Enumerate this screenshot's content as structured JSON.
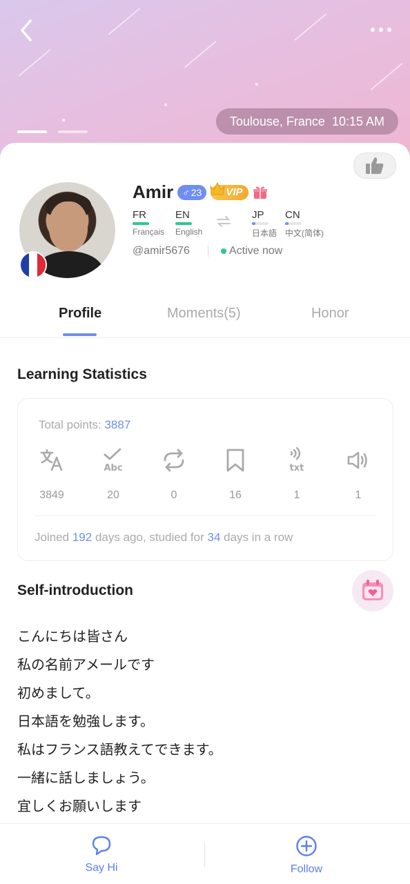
{
  "header": {
    "location": "Toulouse, France",
    "local_time": "10:15 AM",
    "gallery_pages": 2
  },
  "profile": {
    "name": "Amir",
    "gender_symbol": "♂",
    "age": "23",
    "vip_label": "VIP",
    "handle": "@amir5676",
    "status": "Active now",
    "native_languages": [
      {
        "code": "FR",
        "name": "Français",
        "level": 1.0
      },
      {
        "code": "EN",
        "name": "English",
        "level": 1.0
      }
    ],
    "learning_languages": [
      {
        "code": "JP",
        "name": "日本語",
        "level": 0.2
      },
      {
        "code": "CN",
        "name": "中文(简体)",
        "level": 0.2
      }
    ]
  },
  "tabs": [
    {
      "label": "Profile",
      "active": true
    },
    {
      "label": "Moments(5)",
      "active": false
    },
    {
      "label": "Honor",
      "active": false
    }
  ],
  "learning_statistics": {
    "title": "Learning Statistics",
    "total_points_label": "Total points:",
    "total_points": "3887",
    "stats": [
      {
        "icon": "translate-icon",
        "value": "3849"
      },
      {
        "icon": "spellcheck-icon",
        "value": "20"
      },
      {
        "icon": "repeat-icon",
        "value": "0"
      },
      {
        "icon": "bookmark-icon",
        "value": "16"
      },
      {
        "icon": "text-to-speech-icon",
        "value": "1"
      },
      {
        "icon": "speaker-icon",
        "value": "1"
      }
    ],
    "joined_prefix": "Joined",
    "joined_days": "192",
    "joined_middle": "days ago, studied for",
    "streak_days": "34",
    "joined_suffix": "days in a row"
  },
  "self_introduction": {
    "title": "Self-introduction",
    "lines": [
      "こんにちは皆さん",
      "私の名前アメールです",
      "初めまして。",
      "日本語を勉強します。",
      "私はフランス語教えてできます。",
      "一緒に話しましょう。",
      "宜しくお願いします"
    ]
  },
  "bottom_bar": {
    "say_hi": "Say Hi",
    "follow": "Follow"
  },
  "colors": {
    "accent": "#6f8ef0",
    "native_bar": "#2ec794",
    "online": "#2ec794",
    "vip": "#f3a82f"
  }
}
